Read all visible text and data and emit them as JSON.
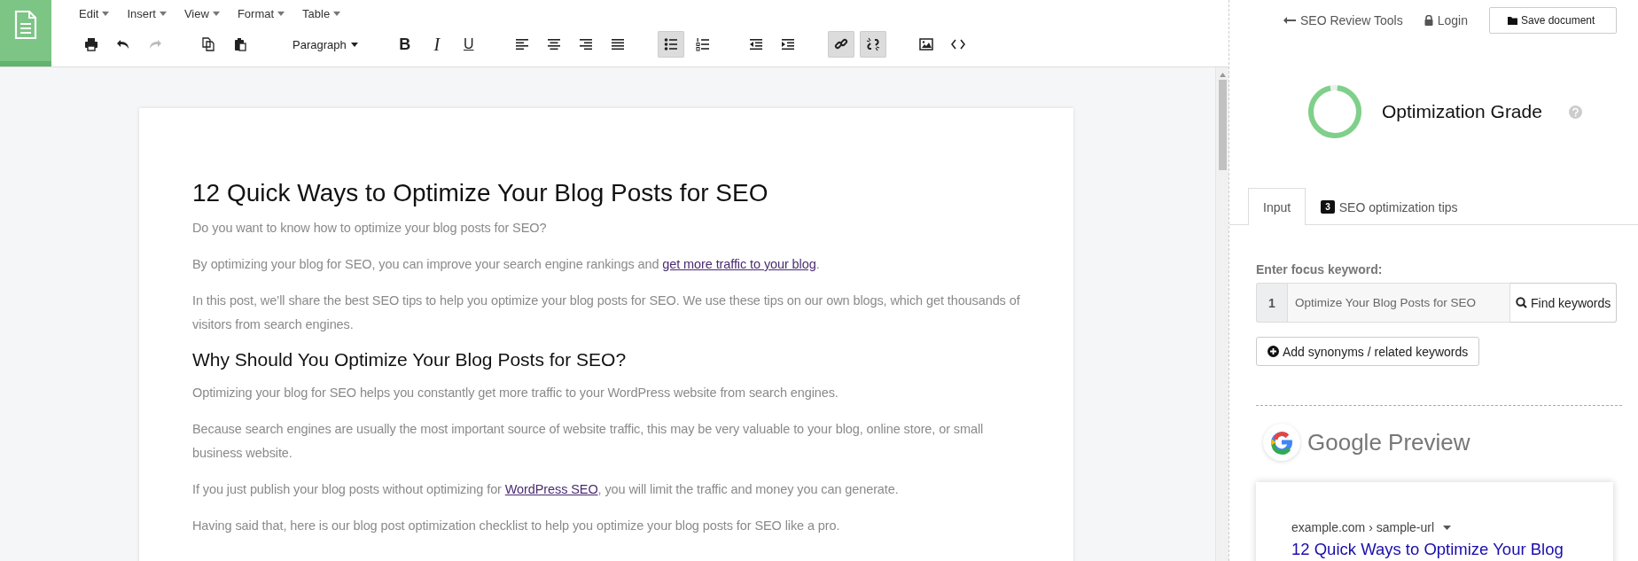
{
  "menu": [
    {
      "label": "Edit"
    },
    {
      "label": "Insert"
    },
    {
      "label": "View"
    },
    {
      "label": "Format"
    },
    {
      "label": "Table"
    }
  ],
  "toolbar": [
    [
      {
        "kind": "print",
        "pressed": false,
        "disabled": false
      },
      {
        "kind": "undo",
        "pressed": false,
        "disabled": false
      },
      {
        "kind": "redo",
        "pressed": false,
        "disabled": true
      }
    ],
    [
      {
        "kind": "copy",
        "pressed": false,
        "disabled": false
      },
      {
        "kind": "paste",
        "pressed": false,
        "disabled": false
      }
    ],
    [
      {
        "kind": "select",
        "label": "Paragraph",
        "pressed": false,
        "disabled": false
      }
    ],
    [
      {
        "kind": "bold",
        "label": "B",
        "pressed": false,
        "disabled": false
      },
      {
        "kind": "italic",
        "label": "I",
        "pressed": false,
        "disabled": false
      },
      {
        "kind": "underline",
        "label": "U",
        "pressed": false,
        "disabled": false
      }
    ],
    [
      {
        "kind": "align-left",
        "pressed": false,
        "disabled": false
      },
      {
        "kind": "align-center",
        "pressed": false,
        "disabled": false
      },
      {
        "kind": "align-right",
        "pressed": false,
        "disabled": false
      },
      {
        "kind": "justify",
        "pressed": false,
        "disabled": false
      }
    ],
    [
      {
        "kind": "bullets",
        "pressed": true,
        "disabled": false
      },
      {
        "kind": "numbers",
        "pressed": false,
        "disabled": false
      }
    ],
    [
      {
        "kind": "outdent",
        "pressed": false,
        "disabled": false
      },
      {
        "kind": "indent",
        "pressed": false,
        "disabled": false
      }
    ],
    [
      {
        "kind": "link",
        "pressed": true,
        "disabled": false
      },
      {
        "kind": "unlink",
        "pressed": true,
        "disabled": false
      }
    ],
    [
      {
        "kind": "image",
        "pressed": false,
        "disabled": false
      },
      {
        "kind": "code",
        "pressed": false,
        "disabled": false
      }
    ]
  ],
  "document": [
    {
      "kind": "h1",
      "segments": [
        {
          "text": "12 Quick Ways to Optimize Your Blog Posts for SEO"
        }
      ]
    },
    {
      "kind": "p",
      "segments": [
        {
          "text": "Do you want to know how to optimize your blog posts for SEO?"
        }
      ]
    },
    {
      "kind": "p",
      "segments": [
        {
          "text": "By optimizing your blog for SEO, you can improve your search engine rankings and "
        },
        {
          "link": "get more traffic to your blog"
        },
        {
          "text": "."
        }
      ]
    },
    {
      "kind": "p",
      "segments": [
        {
          "text": "In this post, we’ll share the best SEO tips to help you optimize your blog posts for SEO. We use these tips on our own blogs, which get thousands of visitors from search engines."
        }
      ]
    },
    {
      "kind": "h2",
      "segments": [
        {
          "text": "Why Should You Optimize Your Blog Posts for SEO?"
        }
      ]
    },
    {
      "kind": "p",
      "segments": [
        {
          "text": "Optimizing your blog for SEO helps you constantly get more traffic to your WordPress website from search engines."
        }
      ]
    },
    {
      "kind": "p",
      "segments": [
        {
          "text": "Because search engines are usually the most important source of website traffic, this may be very valuable to your blog, online store, or small business website."
        }
      ]
    },
    {
      "kind": "p",
      "segments": [
        {
          "text": "If you just publish your blog posts without optimizing for "
        },
        {
          "link": "WordPress SEO"
        },
        {
          "text": ", you will limit the traffic and money you can generate."
        }
      ]
    },
    {
      "kind": "p",
      "segments": [
        {
          "text": "Having said that, here is our blog post optimization checklist to help you optimize your blog posts for SEO like a pro."
        }
      ]
    }
  ],
  "panel": {
    "back_link": "SEO Review Tools",
    "login": "Login",
    "save_button": "Save document",
    "grade": {
      "title": "Optimization Grade",
      "level": 0.95
    },
    "tabs": [
      {
        "label": "Input",
        "selected": true
      },
      {
        "label": "SEO optimization tips",
        "badge": "3",
        "selected": false
      }
    ],
    "keyword_label": "Enter focus keyword:",
    "keyword_index": "1",
    "keyword_value": "Optimize Your Blog Posts for SEO",
    "find_button": "Find keywords",
    "synonyms_button": "Add synonyms / related keywords",
    "preview_title": "Google Preview",
    "preview_url": "example.com › sample-url",
    "preview_heading": "12 Quick Ways to Optimize Your Blog"
  }
}
